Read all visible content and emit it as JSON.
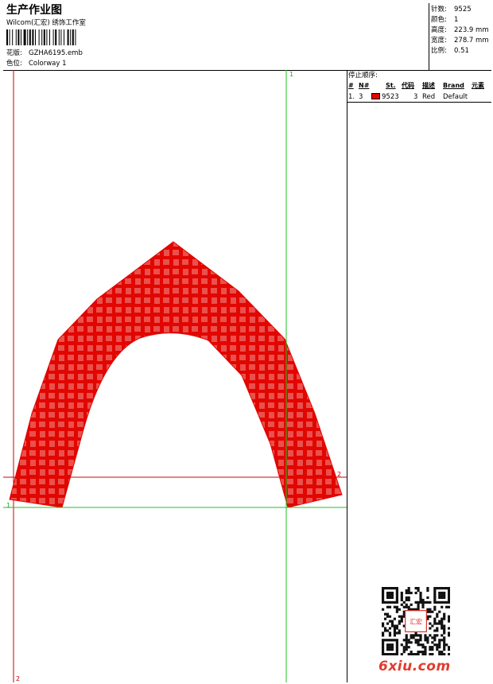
{
  "header": {
    "title": "生产作业图",
    "studio": "Wilcom(汇宏) 绣饰工作室",
    "design_label": "花版:",
    "design_value": "GZHA6195.emb",
    "colorway_label": "色位:",
    "colorway_value": "Colorway 1"
  },
  "stats": {
    "stitches_label": "针数:",
    "stitches": "9525",
    "colors_label": "颜色:",
    "colors": "1",
    "height_label": "高度:",
    "height": "223.9 mm",
    "width_label": "宽度:",
    "width": "278.7 mm",
    "scale_label": "比例:",
    "scale": "0.51"
  },
  "stop_sequence": {
    "title": "停止顺序:",
    "columns": [
      "#",
      "N#",
      "St.",
      "代码",
      "描述",
      "Brand",
      "元素"
    ],
    "rows": [
      {
        "index": "1.",
        "needle": "3",
        "stitches": "9523",
        "code": "3",
        "desc": "Red",
        "brand": "Default",
        "color": "#e10600"
      }
    ]
  },
  "guides": {
    "green_top": "1",
    "green_left": "1",
    "red_right": "2",
    "red_bottom": "2"
  },
  "design_color": "#e10600",
  "guide_green": "#22c022",
  "guide_red": "#d00000",
  "watermark": "6xiu.com",
  "stamp_text": "汇宏"
}
